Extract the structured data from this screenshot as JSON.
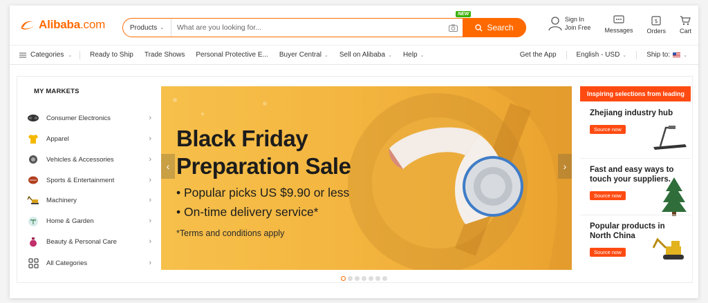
{
  "header": {
    "logo_brand": "Alibaba",
    "logo_domain": ".com",
    "search": {
      "category": "Products",
      "placeholder": "What are you looking for...",
      "new_badge": "NEW",
      "button_label": "Search"
    },
    "signin": {
      "line1": "Sign In",
      "line2": "Join Free"
    },
    "messages_label": "Messages",
    "orders_label": "Orders",
    "cart_label": "Cart"
  },
  "nav": {
    "categories_label": "Categories",
    "links": [
      "Ready to Ship",
      "Trade Shows",
      "Personal Protective E...",
      "Buyer Central",
      "Sell on Alibaba",
      "Help"
    ],
    "get_app": "Get the App",
    "language_currency": "English - USD",
    "ship_to": "Ship to:"
  },
  "markets": {
    "title": "MY MARKETS",
    "items": [
      {
        "label": "Consumer Electronics",
        "icon": "headset-icon"
      },
      {
        "label": "Apparel",
        "icon": "shirt-icon"
      },
      {
        "label": "Vehicles & Accessories",
        "icon": "car-icon"
      },
      {
        "label": "Sports & Entertainment",
        "icon": "ball-icon"
      },
      {
        "label": "Machinery",
        "icon": "excavator-icon"
      },
      {
        "label": "Home & Garden",
        "icon": "plant-icon"
      },
      {
        "label": "Beauty & Personal Care",
        "icon": "perfume-icon"
      },
      {
        "label": "All Categories",
        "icon": "grid-icon"
      }
    ]
  },
  "banner": {
    "title_line1": "Black Friday",
    "title_line2": "Preparation Sale",
    "bullet1": "• Popular picks US $9.90 or less",
    "bullet2": "• On-time delivery service*",
    "terms": "*Terms and conditions apply",
    "slide_count": 7,
    "active_slide": 1
  },
  "aside": {
    "header": "Inspiring selections from leading",
    "cards": [
      {
        "title": "Zhejiang industry hub",
        "button": "Source now",
        "icon": "treadmill-icon"
      },
      {
        "title": "Fast and easy ways to touch your suppliers.",
        "button": "Source now",
        "icon": "christmas-tree-icon"
      },
      {
        "title": "Popular products in North China",
        "button": "Source now",
        "icon": "excavator-icon"
      }
    ]
  },
  "colors": {
    "brand": "#ff6a00",
    "accent_red": "#ff4b12",
    "badge_green": "#38b000"
  }
}
